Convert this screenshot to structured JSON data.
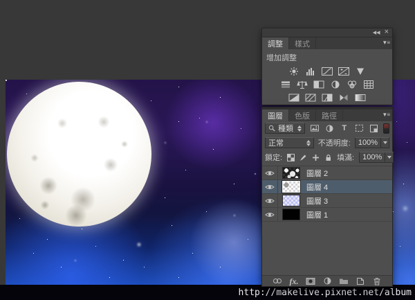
{
  "watermark": {
    "url_text": "http://makelive.pixnet.net/album"
  },
  "adjustments_panel": {
    "controls": {
      "collapse_glyph": "◀◀",
      "close_glyph": "×",
      "menu_glyph": "▼≡"
    },
    "tabs": {
      "adjustments": "調整",
      "styles": "樣式"
    },
    "section_label": "增加調整",
    "icon_names": [
      "brightness-contrast",
      "levels",
      "curves",
      "exposure",
      "vibrance",
      "hue-saturation",
      "color-balance",
      "black-white",
      "photo-filter",
      "channel-mixer",
      "color-lookup",
      "invert",
      "posterize",
      "threshold",
      "selective-color",
      "gradient-map"
    ]
  },
  "layers_panel": {
    "controls": {
      "menu_glyph": "▼≡"
    },
    "tabs": {
      "layers": "圖層",
      "channels": "色版",
      "paths": "路徑"
    },
    "filter_row": {
      "kind_label": "種類",
      "type_glyph": "T"
    },
    "blend_row": {
      "mode_value": "正常",
      "opacity_label": "不透明度:",
      "opacity_value": "100%"
    },
    "lock_row": {
      "lock_label": "鎖定:",
      "fill_label": "填滿:",
      "fill_value": "100%"
    },
    "footer": {
      "fx_glyph": "fx."
    },
    "layers": [
      {
        "name": "圖層 2",
        "selected": false
      },
      {
        "name": "圖層 4",
        "selected": true
      },
      {
        "name": "圖層 3",
        "selected": false
      },
      {
        "name": "圖層 1",
        "selected": false
      }
    ]
  },
  "colors": {
    "workspace_bg": "#383838",
    "panel_bg": "#4e4e4e",
    "selection_row": "#4e5d6b",
    "strip_bg": "#04040a"
  }
}
